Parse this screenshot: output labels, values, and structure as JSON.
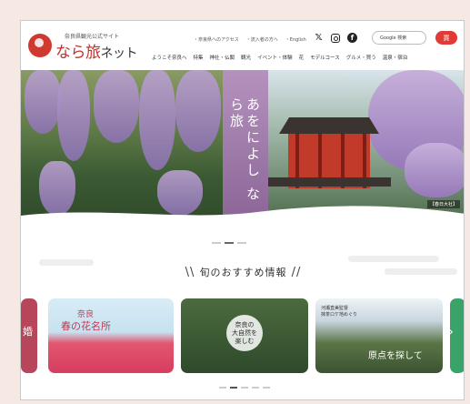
{
  "header": {
    "logo_sub": "奈良県観光公式サイト",
    "logo_main": "なら旅",
    "logo_net": "ネット",
    "util_links": [
      "・奈良県へのアクセス",
      "・流入者の方へ",
      "・English"
    ],
    "google_search": "Google 検索",
    "cart_label": "買",
    "nav": [
      "ようこそ奈良へ",
      "特集",
      "神社・仏閣",
      "観光",
      "イベント・体験",
      "花",
      "モデルコース",
      "グルメ・買う",
      "温泉・宿泊"
    ]
  },
  "hero": {
    "title": "あをによし なら旅",
    "caption": "【春日大社】"
  },
  "section": {
    "title": "旬のおすすめ情報"
  },
  "cards": [
    {
      "text": "婚"
    },
    {
      "line1": "奈良",
      "line2": "春の花名所"
    },
    {
      "line1": "奈良の",
      "line2": "大自然を",
      "line3": "楽しむ"
    },
    {
      "line1": "河瀬直美監督",
      "line2": "抹茶ロケ地めぐり",
      "line3": "原点を探して"
    }
  ],
  "colors": {
    "brand_red": "#c42e2a",
    "page_bg": "#f6e8e2"
  }
}
